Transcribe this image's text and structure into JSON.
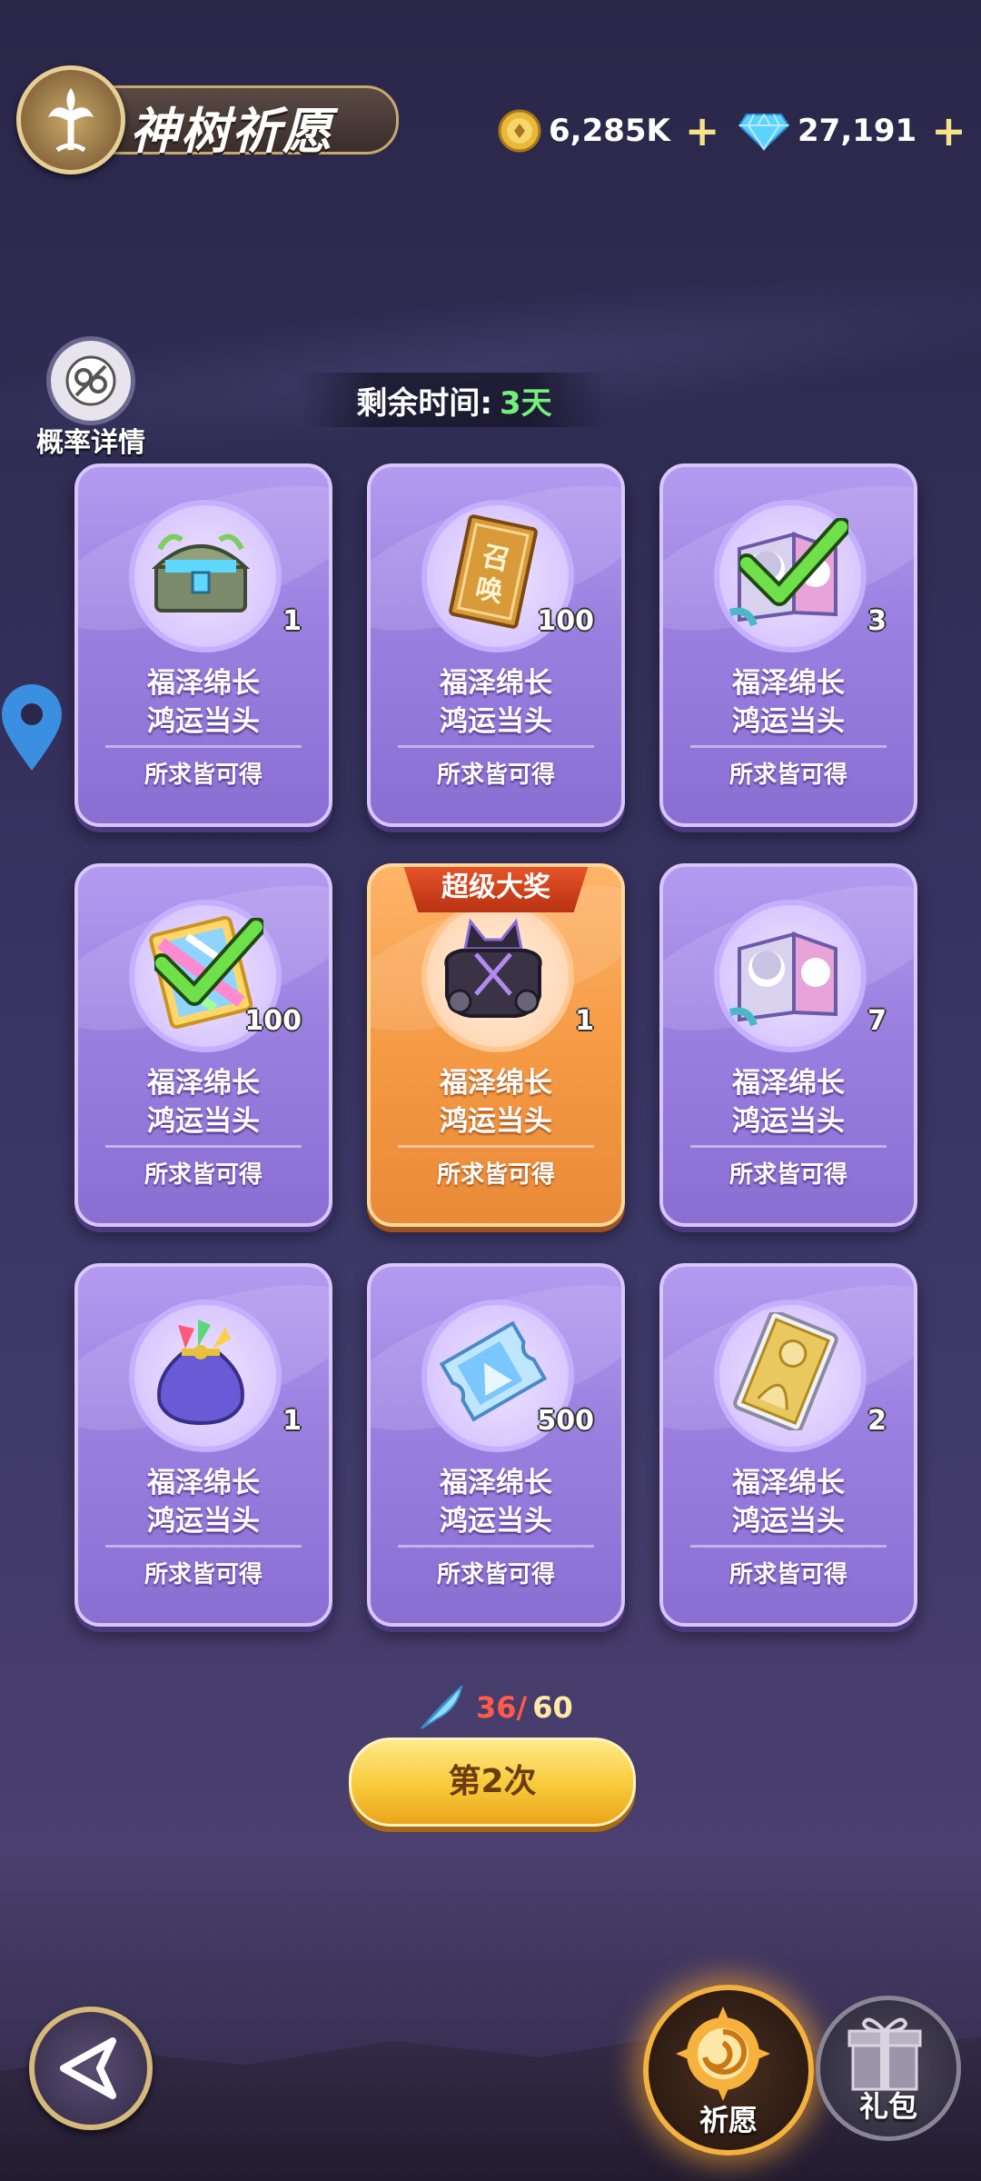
{
  "header": {
    "title": "神树祈愿",
    "gold": {
      "icon": "gold-coin-icon",
      "value": "6,285K",
      "plus": "+"
    },
    "diamond": {
      "icon": "diamond-icon",
      "value": "27,191",
      "plus": "+"
    }
  },
  "prob_details": {
    "label": "概率详情",
    "icon": "probability-icon"
  },
  "timer": {
    "label": "剩余时间:",
    "value": "3天"
  },
  "cards": [
    {
      "item": "treasure-chest-icon",
      "qty": "1",
      "line1": "福泽绵长",
      "line2": "鸿运当头",
      "sub": "所求皆可得",
      "claimed": false,
      "super": false
    },
    {
      "item": "summon-scroll-icon",
      "qty": "100",
      "line1": "福泽绵长",
      "line2": "鸿运当头",
      "sub": "所求皆可得",
      "claimed": false,
      "super": false,
      "scroll_text": "召唤"
    },
    {
      "item": "hero-gift-box-icon",
      "qty": "3",
      "line1": "福泽绵长",
      "line2": "鸿运当头",
      "sub": "所求皆可得",
      "claimed": true,
      "super": false
    },
    {
      "item": "rainbow-card-icon",
      "qty": "100",
      "line1": "福泽绵长",
      "line2": "鸿运当头",
      "sub": "所求皆可得",
      "claimed": true,
      "super": false
    },
    {
      "item": "armor-gauntlet-icon",
      "qty": "1",
      "line1": "福泽绵长",
      "line2": "鸿运当头",
      "sub": "所求皆可得",
      "claimed": false,
      "super": true,
      "banner": "超级大奖"
    },
    {
      "item": "hero-gift-box-icon",
      "qty": "7",
      "line1": "福泽绵长",
      "line2": "鸿运当头",
      "sub": "所求皆可得",
      "claimed": false,
      "super": false
    },
    {
      "item": "candy-bag-icon",
      "qty": "1",
      "line1": "福泽绵长",
      "line2": "鸿运当头",
      "sub": "所求皆可得",
      "claimed": false,
      "super": false
    },
    {
      "item": "ticket-icon",
      "qty": "500",
      "line1": "福泽绵长",
      "line2": "鸿运当头",
      "sub": "所求皆可得",
      "claimed": false,
      "super": false
    },
    {
      "item": "tarot-card-icon",
      "qty": "2",
      "line1": "福泽绵长",
      "line2": "鸿运当头",
      "sub": "所求皆可得",
      "claimed": false,
      "super": false
    }
  ],
  "progress": {
    "icon": "feather-icon",
    "current": "36/",
    "total": "60"
  },
  "wish_button": {
    "label": "第2次"
  },
  "nav": {
    "back": {
      "icon": "back-arrow-icon"
    },
    "wish": {
      "label": "祈愿",
      "icon": "wish-emblem-icon"
    },
    "gift": {
      "label": "礼包",
      "icon": "gift-box-icon"
    }
  },
  "colors": {
    "card": "#9b7fe0",
    "super_card": "#f59a45",
    "timer_value": "#74f07a",
    "progress_current": "#ff5a48",
    "button": "#f8c938"
  }
}
